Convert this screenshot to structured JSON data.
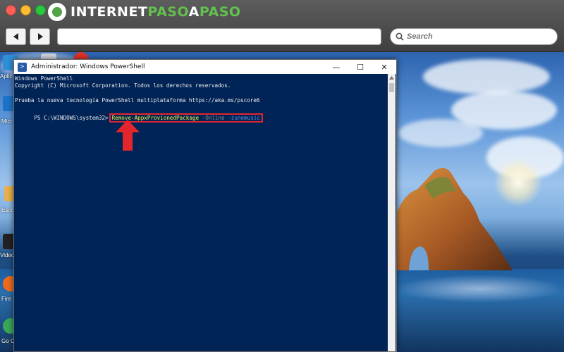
{
  "browser": {
    "brand_part1": "INTERNET",
    "brand_part2": "PASO",
    "brand_part3": "A",
    "brand_part4": "PASO",
    "url": "",
    "search_placeholder": "Search",
    "colors": {
      "close": "#ff5f57",
      "minimize": "#febc2e",
      "maximize": "#28c840",
      "brand_green": "#63c14f"
    }
  },
  "desktop": {
    "icons": [
      {
        "label": "Aplic qu"
      },
      {
        "label": "Micr"
      },
      {
        "label": "Escr"
      },
      {
        "label": "Video"
      },
      {
        "label": "Fire"
      },
      {
        "label": "Go Chr"
      }
    ]
  },
  "window": {
    "title": "Administrador: Windows PowerShell",
    "minimize_glyph": "—",
    "maximize_glyph": "☐",
    "close_glyph": "✕",
    "background": "#012456"
  },
  "console": {
    "lines": [
      "Windows PowerShell",
      "Copyright (C) Microsoft Corporation. Todos los derechos reservados.",
      "",
      "Prueba la nueva tecnología PowerShell multiplataforma https://aka.ms/pscore6"
    ],
    "prompt": "PS C:\\WINDOWS\\system32>",
    "command": "Remove-AppxProvionedPackage",
    "param": "-Online",
    "arg": "-zunemusic",
    "highlight_color": "#e3262e"
  }
}
